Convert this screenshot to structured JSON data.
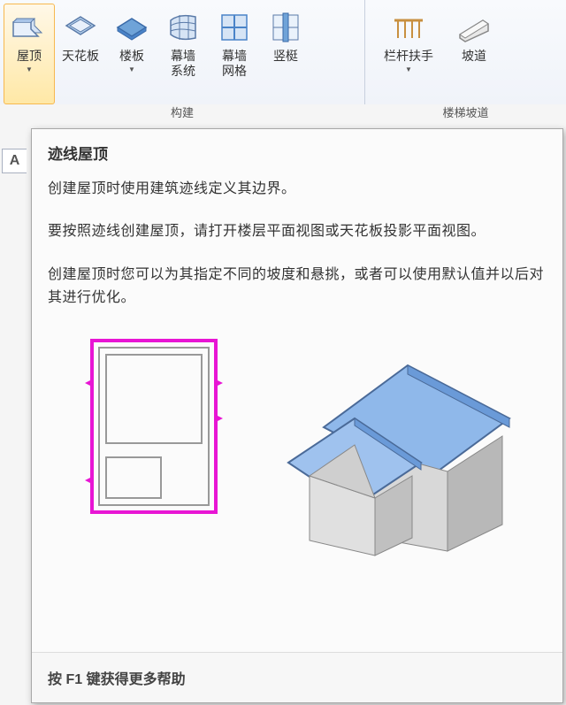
{
  "ribbon": {
    "group1": {
      "label": "构建",
      "items": [
        {
          "label": "屋顶",
          "hasDropdown": true,
          "selected": true
        },
        {
          "label": "天花板",
          "hasDropdown": false
        },
        {
          "label": "楼板",
          "hasDropdown": true
        },
        {
          "label": "幕墙\n系统",
          "hasDropdown": false
        },
        {
          "label": "幕墙\n网格",
          "hasDropdown": false
        },
        {
          "label": "竖梃",
          "hasDropdown": false
        }
      ]
    },
    "group2": {
      "label": "楼梯坡道",
      "items": [
        {
          "label": "栏杆扶手",
          "hasDropdown": true
        },
        {
          "label": "坡道",
          "hasDropdown": false
        }
      ]
    }
  },
  "sideTab": {
    "label": "A"
  },
  "tooltip": {
    "title": "迹线屋顶",
    "desc": "创建屋顶时使用建筑迹线定义其边界。",
    "p1": "要按照迹线创建屋顶，请打开楼层平面视图或天花板投影平面视图。",
    "p2": "创建屋顶时您可以为其指定不同的坡度和悬挑，或者可以使用默认值并以后对其进行优化。",
    "footer": "按 F1 键获得更多帮助"
  }
}
